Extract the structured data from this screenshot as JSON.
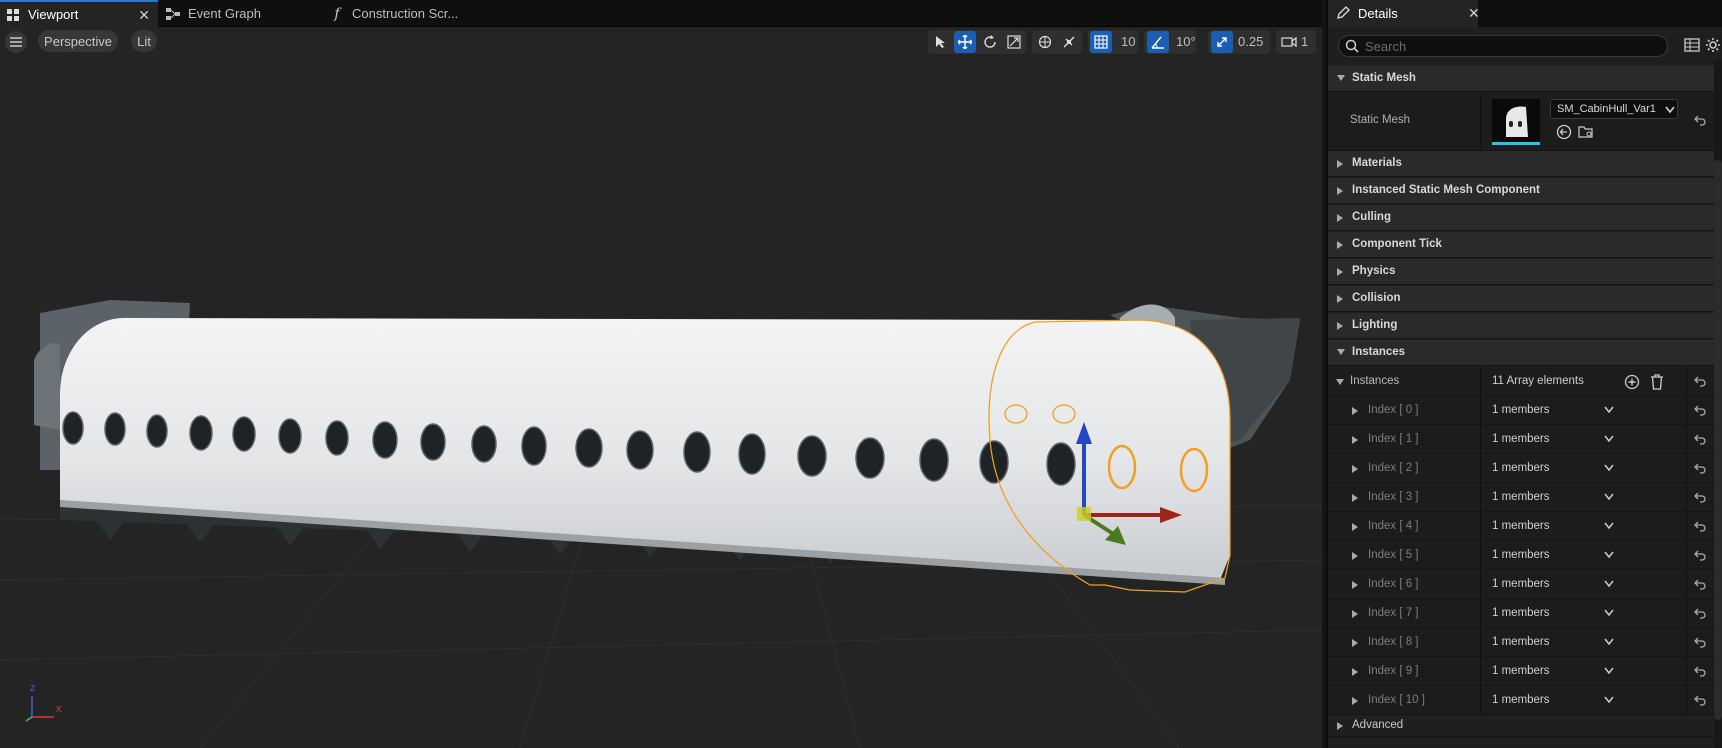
{
  "tabs": [
    {
      "label": "Viewport",
      "icon": "viewport-grid-icon",
      "active": true
    },
    {
      "label": "Event Graph",
      "icon": "event-graph-icon",
      "active": false
    },
    {
      "label": "Construction Scr...",
      "icon": "function-icon",
      "active": false
    }
  ],
  "viewport": {
    "view_mode": "Perspective",
    "lighting_mode": "Lit",
    "grid_snap": "10",
    "rotation_snap": "10°",
    "scale_snap": "0.25",
    "camera_speed": "1",
    "axis_x_label": "x",
    "axis_z_label": "z"
  },
  "details": {
    "tab_label": "Details",
    "search_placeholder": "Search",
    "static_mesh_category": "Static Mesh",
    "static_mesh_label": "Static Mesh",
    "static_mesh_value": "SM_CabinHull_Var1",
    "categories": [
      "Materials",
      "Instanced Static Mesh Component",
      "Culling",
      "Component Tick",
      "Physics",
      "Collision",
      "Lighting"
    ],
    "instances_category": "Instances",
    "instances_label": "Instances",
    "instances_count": "11 Array elements",
    "indices": [
      {
        "label": "Index [ 0 ]",
        "value": "1 members"
      },
      {
        "label": "Index [ 1 ]",
        "value": "1 members"
      },
      {
        "label": "Index [ 2 ]",
        "value": "1 members"
      },
      {
        "label": "Index [ 3 ]",
        "value": "1 members"
      },
      {
        "label": "Index [ 4 ]",
        "value": "1 members"
      },
      {
        "label": "Index [ 5 ]",
        "value": "1 members"
      },
      {
        "label": "Index [ 6 ]",
        "value": "1 members"
      },
      {
        "label": "Index [ 7 ]",
        "value": "1 members"
      },
      {
        "label": "Index [ 8 ]",
        "value": "1 members"
      },
      {
        "label": "Index [ 9 ]",
        "value": "1 members"
      },
      {
        "label": "Index [ 10 ]",
        "value": "1 members"
      }
    ],
    "advanced_label": "Advanced"
  },
  "colors": {
    "accent": "#1a5fb4",
    "selection": "#f0a020",
    "panel": "#1f1f1f",
    "viewport_bg": "#242424"
  }
}
